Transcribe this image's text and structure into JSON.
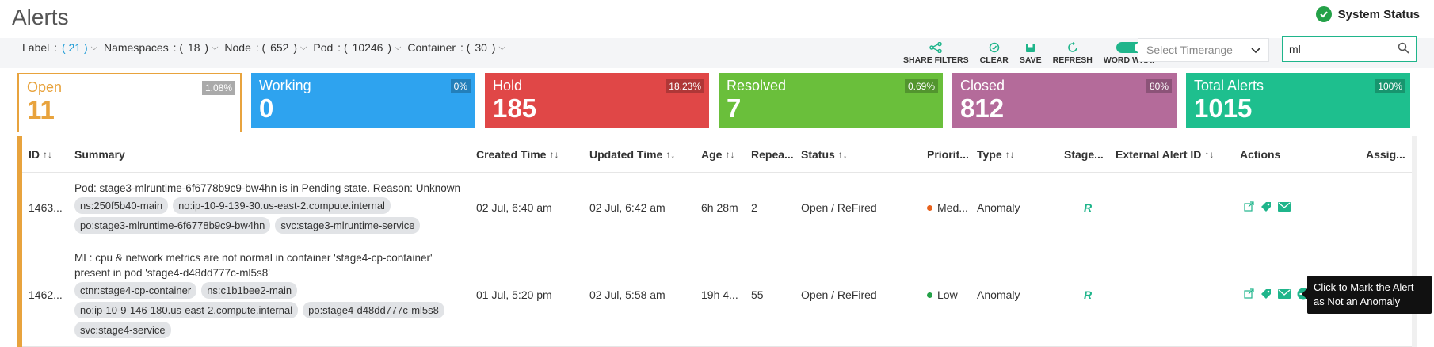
{
  "header": {
    "title": "Alerts",
    "system_status_label": "System Status",
    "status_icon": "check-circle-icon",
    "status_color": "#24a148"
  },
  "filters": [
    {
      "name": "Label",
      "count": "21"
    },
    {
      "name": "Namespaces",
      "count": "18"
    },
    {
      "name": "Node",
      "count": "652"
    },
    {
      "name": "Pod",
      "count": "10246"
    },
    {
      "name": "Container",
      "count": "30"
    }
  ],
  "toolbar": {
    "share_filters": "SHARE FILTERS",
    "clear": "CLEAR",
    "save": "SAVE",
    "refresh": "REFRESH",
    "word_wrap": "WORD WRAP",
    "word_wrap_on": true
  },
  "timerange": {
    "placeholder": "Select Timerange"
  },
  "search": {
    "value": "ml"
  },
  "cards": [
    {
      "label": "Open",
      "value": "11",
      "pct": "1.08%",
      "color": "#e8a33d"
    },
    {
      "label": "Working",
      "value": "0",
      "pct": "0%",
      "color": "#2ea3ef"
    },
    {
      "label": "Hold",
      "value": "185",
      "pct": "18.23%",
      "color": "#e04747"
    },
    {
      "label": "Resolved",
      "value": "7",
      "pct": "0.69%",
      "color": "#6abf3b"
    },
    {
      "label": "Closed",
      "value": "812",
      "pct": "80%",
      "color": "#b46b9a"
    },
    {
      "label": "Total Alerts",
      "value": "1015",
      "pct": "100%",
      "color": "#1ebf8e"
    }
  ],
  "table": {
    "columns": {
      "id": "ID",
      "summary": "Summary",
      "created": "Created Time",
      "updated": "Updated Time",
      "age": "Age",
      "repeat": "Repea...",
      "status": "Status",
      "priority": "Priorit...",
      "type": "Type",
      "stage": "Stage...",
      "external": "External Alert ID",
      "actions": "Actions",
      "assign": "Assig..."
    },
    "rows": [
      {
        "id": "1463...",
        "summary": "Pod: stage3-mlruntime-6f6778b9c9-bw4hn is in Pending state. Reason: Unknown",
        "tags": [
          "ns:250f5b40-main",
          "no:ip-10-9-139-30.us-east-2.compute.internal",
          "po:stage3-mlruntime-6f6778b9c9-bw4hn",
          "svc:stage3-mlruntime-service"
        ],
        "created": "02 Jul, 6:40 am",
        "updated": "02 Jul, 6:42 am",
        "age": "6h 28m",
        "repeat": "2",
        "status": "Open / ReFired",
        "priority": "Med...",
        "priority_color": "#e8621c",
        "type": "Anomaly",
        "stage": "R"
      },
      {
        "id": "1462...",
        "summary_line1": "ML: cpu & network metrics are not normal in container 'stage4-cp-container'",
        "summary_line2": "present in pod 'stage4-d48dd777c-ml5s8'",
        "tags": [
          "ctnr:stage4-cp-container",
          "ns:c1b1bee2-main",
          "no:ip-10-9-146-180.us-east-2.compute.internal",
          "po:stage4-d48dd777c-ml5s8",
          "svc:stage4-service"
        ],
        "created": "01 Jul, 5:20 pm",
        "updated": "02 Jul, 5:58 am",
        "age": "19h 4...",
        "repeat": "55",
        "status": "Open / ReFired",
        "priority": "Low",
        "priority_color": "#24a148",
        "type": "Anomaly",
        "stage": "R"
      }
    ]
  },
  "tooltip": {
    "text_line1": "Click to Mark the Alert",
    "text_line2": "as Not an Anomaly"
  }
}
